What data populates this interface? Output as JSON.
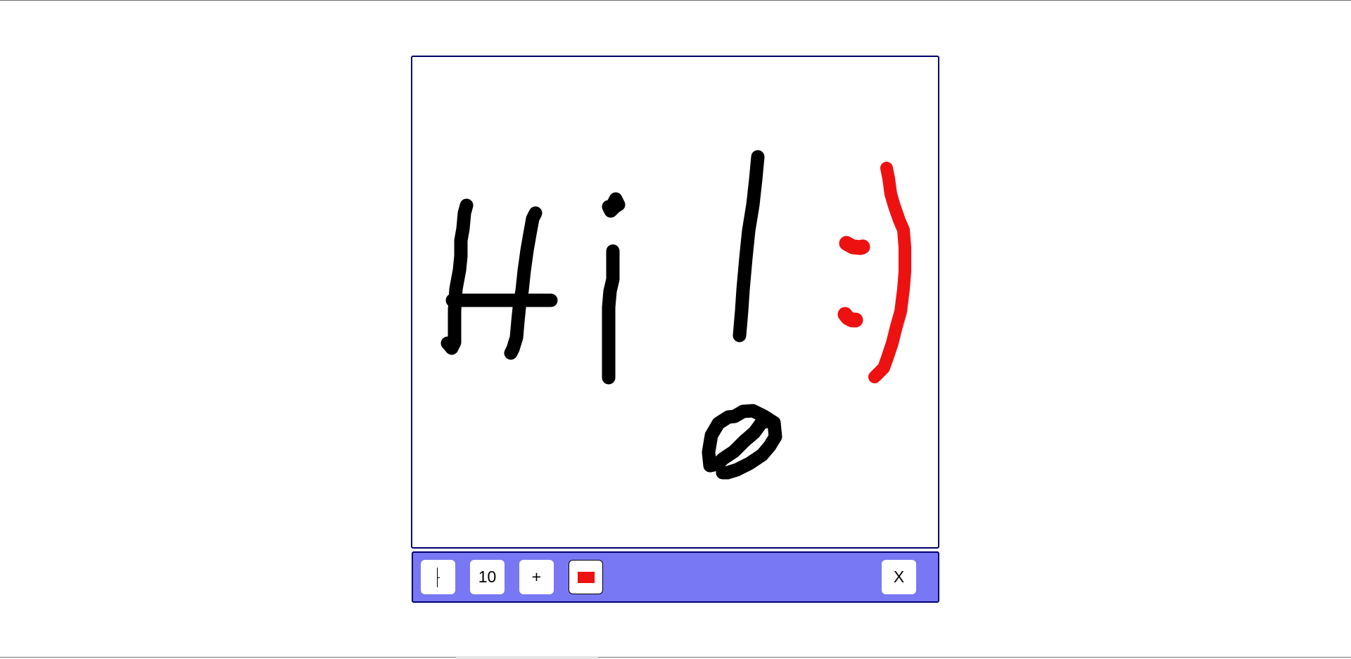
{
  "toolbar": {
    "pen_tool_icon": "pen-cursor-icon",
    "brush_size_label": "10",
    "add_label": "+",
    "current_color": "#ee1111",
    "clear_label": "X"
  },
  "canvas": {
    "background": "#ffffff",
    "border_color": "#00006e",
    "ink_colors": [
      "#000000",
      "#ee1111"
    ]
  },
  "colors": {
    "toolbar_bg": "#7878f4",
    "frame_border": "#00006e"
  }
}
